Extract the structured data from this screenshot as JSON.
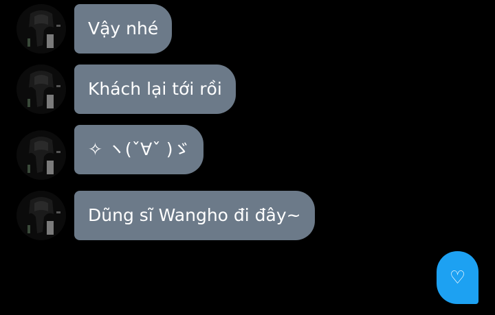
{
  "messages": [
    {
      "text": "Vậy nhé"
    },
    {
      "text": "Khách lại tới rồi"
    },
    {
      "text": "✧ ヽ(ˇ∀ˇ )ゞ"
    },
    {
      "text": "Dũng sĩ Wangho đi đây~"
    }
  ],
  "colors": {
    "background": "#000000",
    "bubble": "#6c7a89",
    "accent": "#1da1f2",
    "text": "#ffffff"
  },
  "heart_button": {
    "icon": "heart-icon",
    "glyph": "♡"
  }
}
